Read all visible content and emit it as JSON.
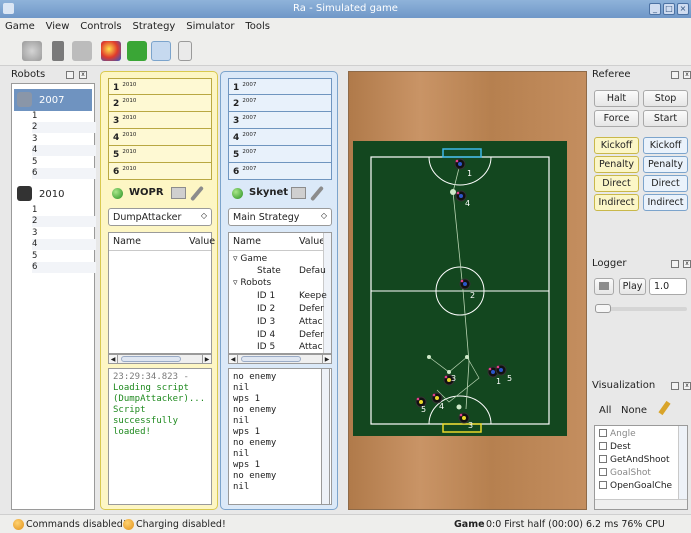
{
  "window": {
    "title": "Ra - Simulated game"
  },
  "menu": {
    "items": [
      "Game",
      "View",
      "Controls",
      "Strategy",
      "Simulator",
      "Tools"
    ]
  },
  "robots_panel": {
    "title": "Robots",
    "teams": [
      {
        "label": "2007",
        "ids": [
          "1",
          "2",
          "3",
          "4",
          "5",
          "6"
        ]
      },
      {
        "label": "2010",
        "ids": [
          "1",
          "2",
          "3",
          "4",
          "5",
          "6"
        ]
      }
    ]
  },
  "yellow_team": {
    "color": "#fdf6c4",
    "slots": [
      {
        "n": "1",
        "gen": "2010"
      },
      {
        "n": "2",
        "gen": "2010"
      },
      {
        "n": "3",
        "gen": "2010"
      },
      {
        "n": "4",
        "gen": "2010"
      },
      {
        "n": "5",
        "gen": "2010"
      },
      {
        "n": "6",
        "gen": "2010"
      }
    ],
    "name": "WOPR",
    "strategy": "DumpAttacker",
    "columns": [
      "Name",
      "Value"
    ],
    "console_lines": [
      "23:29:34.823 -",
      "Loading script",
      "(DumpAttacker)...",
      "Script",
      "successfully",
      "loaded!"
    ]
  },
  "blue_team": {
    "color": "#dbe9f8",
    "slots": [
      {
        "n": "1",
        "gen": "2007"
      },
      {
        "n": "2",
        "gen": "2007"
      },
      {
        "n": "3",
        "gen": "2007"
      },
      {
        "n": "4",
        "gen": "2007"
      },
      {
        "n": "5",
        "gen": "2007"
      },
      {
        "n": "6",
        "gen": "2007"
      }
    ],
    "name": "Skynet",
    "strategy": "Main Strategy",
    "columns": [
      "Name",
      "Value"
    ],
    "tree": {
      "game": {
        "label": "Game",
        "state_name": "State",
        "state_value": "Defau"
      },
      "robots": {
        "label": "Robots",
        "rows": [
          {
            "id": "ID 1",
            "value": "Keepe"
          },
          {
            "id": "ID 2",
            "value": "Defer"
          },
          {
            "id": "ID 3",
            "value": "Attac"
          },
          {
            "id": "ID 4",
            "value": "Defer"
          },
          {
            "id": "ID 5",
            "value": "Attac"
          }
        ]
      }
    },
    "console_lines": [
      "no enemy",
      "nil",
      "wps 1",
      "no enemy",
      "nil",
      "wps 1",
      "no enemy",
      "nil",
      "wps 1",
      "no enemy",
      "nil"
    ]
  },
  "field": {
    "robot_labels": [
      "1",
      "4",
      "2",
      "3",
      "4",
      "5",
      "1",
      "5",
      "3"
    ]
  },
  "referee": {
    "title": "Referee",
    "halt": "Halt",
    "stop": "Stop",
    "force": "Force",
    "start": "Start",
    "kickoff_yellow": "Kickoff",
    "kickoff_blue": "Kickoff",
    "penalty_yellow": "Penalty",
    "penalty_blue": "Penalty",
    "direct_yellow": "Direct",
    "direct_blue": "Direct",
    "indirect_yellow": "Indirect",
    "indirect_blue": "Indirect"
  },
  "logger": {
    "title": "Logger",
    "play": "Play",
    "speed": "1.0"
  },
  "visualization": {
    "title": "Visualization",
    "all": "All",
    "none": "None",
    "items": [
      "Angle",
      "Dest",
      "GetAndShoot",
      "GoalShot",
      "OpenGoalChe"
    ]
  },
  "status": {
    "commands": "Commands disabled!",
    "charging": "Charging disabled!",
    "game_label": "Game",
    "game_info": "0:0 First half (00:00) 6.2 ms 76% CPU"
  }
}
